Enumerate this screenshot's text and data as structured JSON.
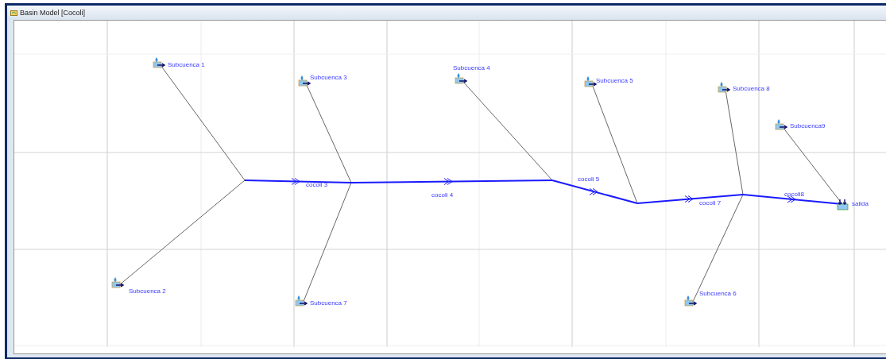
{
  "window": {
    "title": "Basin Model [Cocoli]"
  },
  "subbasins": [
    {
      "name": "Subcuenca 1"
    },
    {
      "name": "Subcuenca 2"
    },
    {
      "name": "Subcuenca 3"
    },
    {
      "name": "Subcuenca 7"
    },
    {
      "name": "Subcuenca 4"
    },
    {
      "name": "Subcuenca 5"
    },
    {
      "name": "Subcuenca 8"
    },
    {
      "name": "Subcuenca 6"
    },
    {
      "name": "Subcuenca9"
    }
  ],
  "reaches": [
    {
      "name": "cocoli 3"
    },
    {
      "name": "cocoli 4"
    },
    {
      "name": "cocoli 5"
    },
    {
      "name": "cocoli 7"
    },
    {
      "name": "cocoli8"
    }
  ],
  "sink": {
    "name": "salida"
  }
}
